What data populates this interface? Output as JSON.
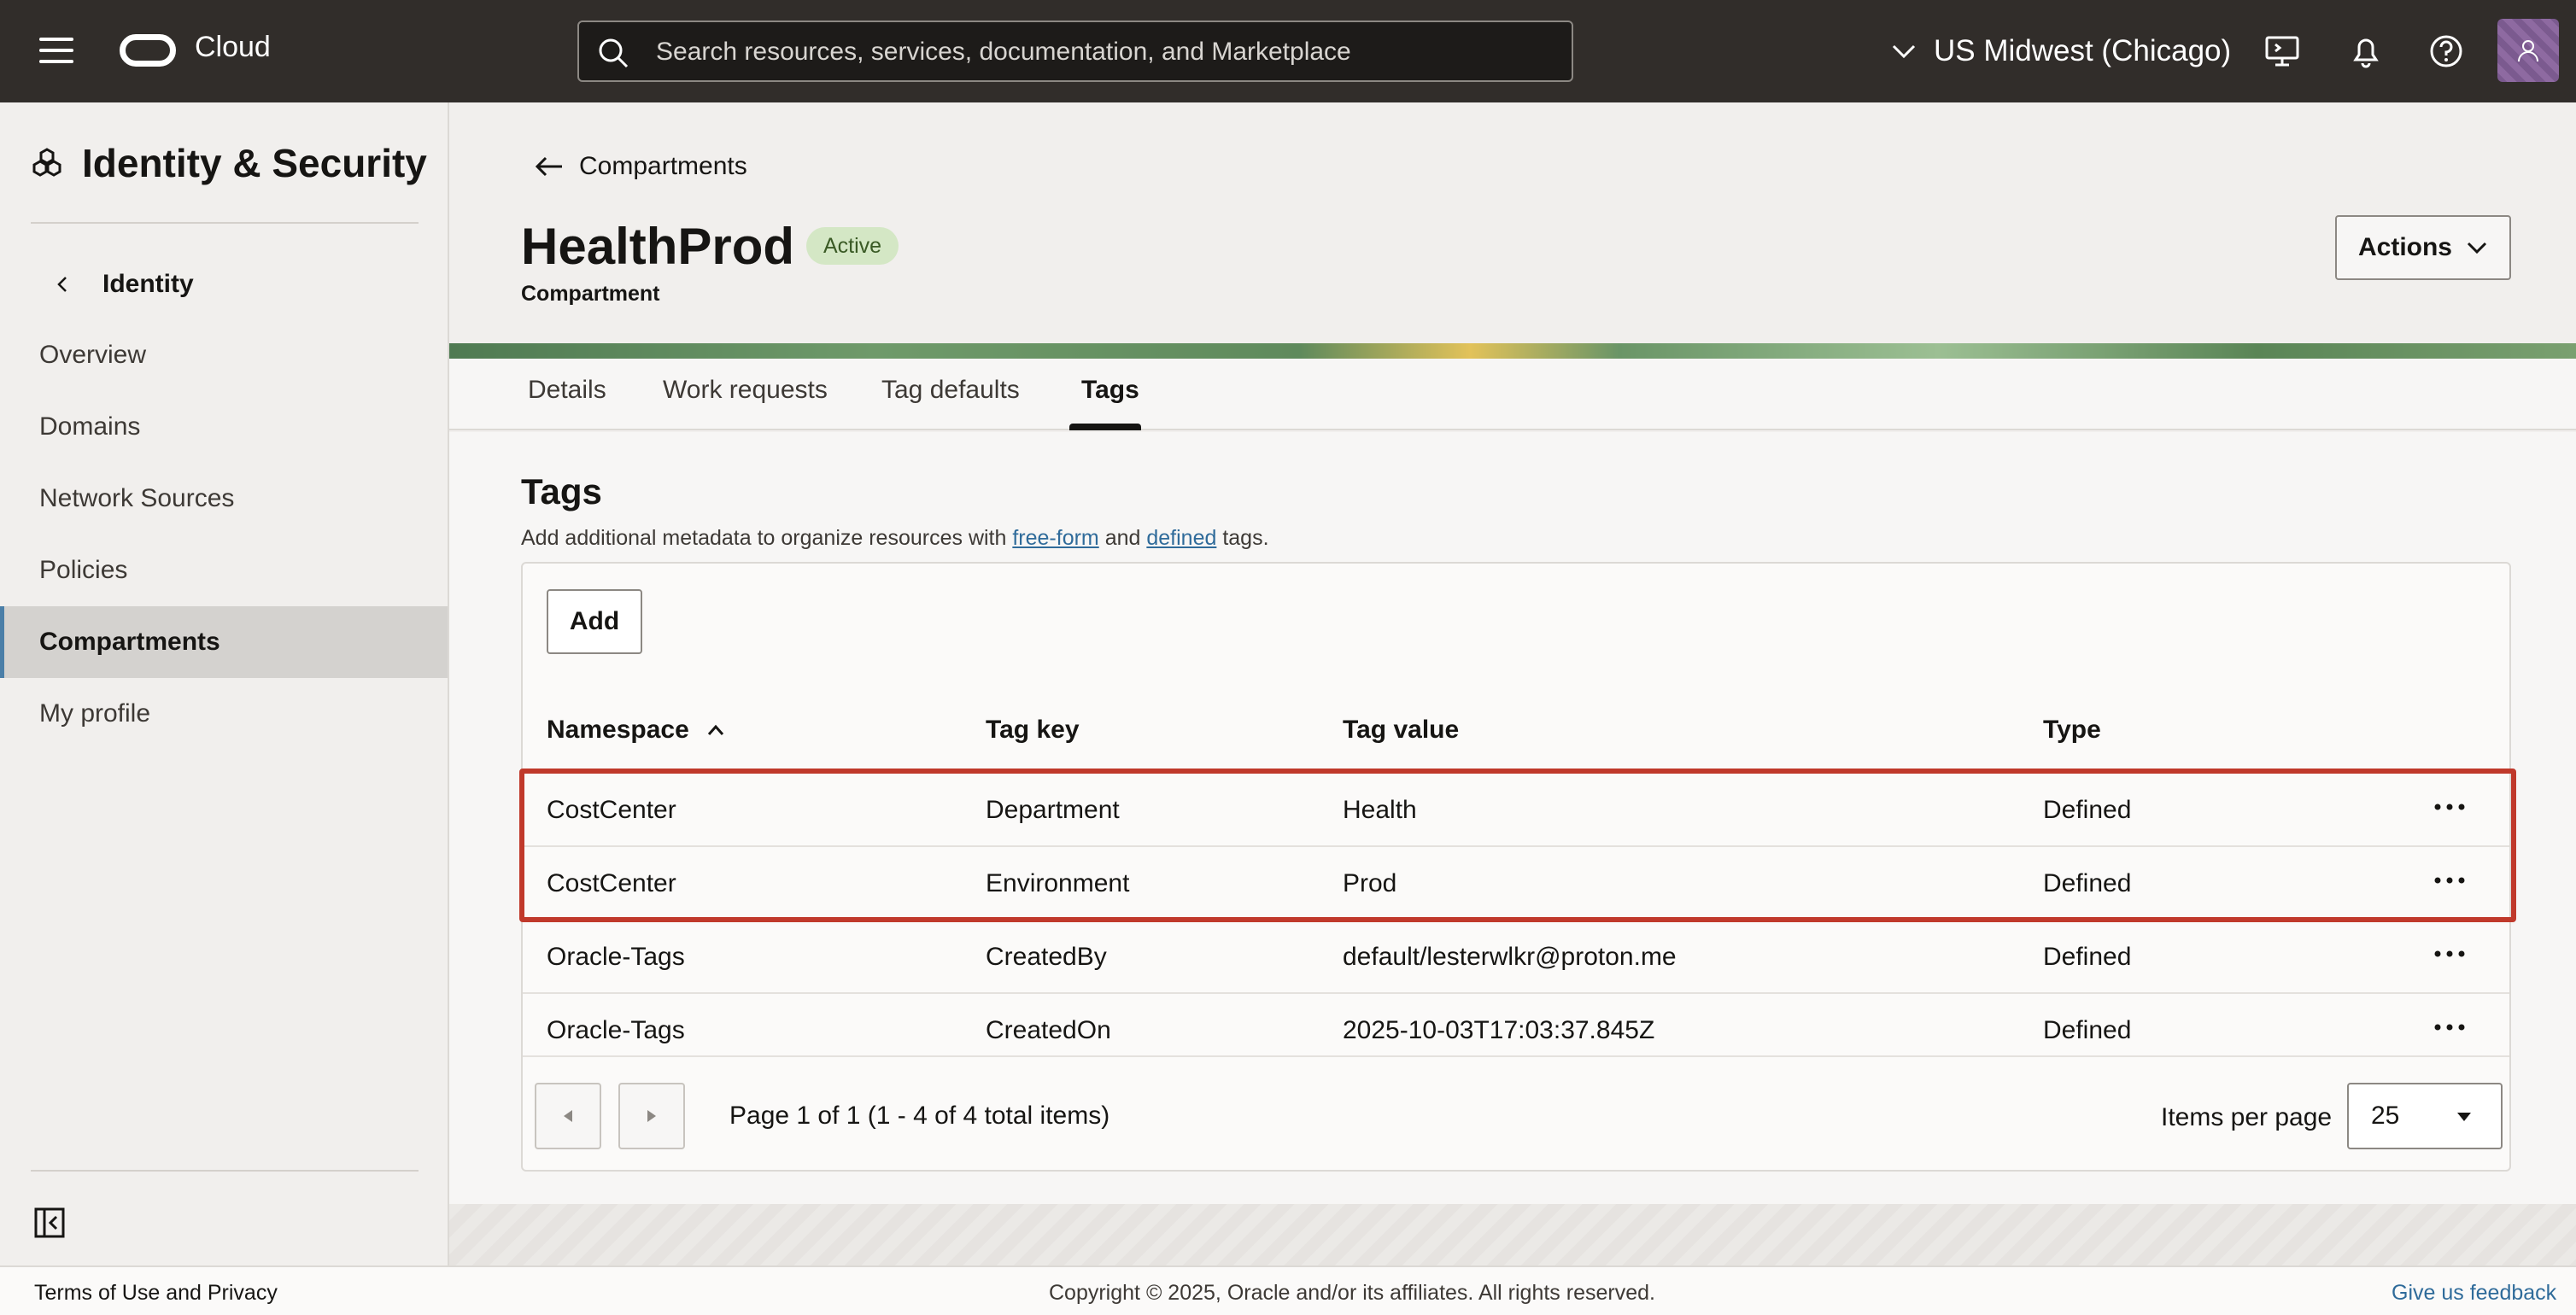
{
  "topbar": {
    "cloud_label": "Cloud",
    "search_placeholder": "Search resources, services, documentation, and Marketplace",
    "region": "US Midwest (Chicago)"
  },
  "sidebar": {
    "title": "Identity & Security",
    "back_label": "Identity",
    "items": [
      {
        "label": "Overview",
        "active": false
      },
      {
        "label": "Domains",
        "active": false
      },
      {
        "label": "Network Sources",
        "active": false
      },
      {
        "label": "Policies",
        "active": false
      },
      {
        "label": "Compartments",
        "active": true
      },
      {
        "label": "My profile",
        "active": false
      }
    ]
  },
  "resource": {
    "breadcrumb": "Compartments",
    "title": "HealthProd",
    "status": "Active",
    "subtitle": "Compartment",
    "actions_label": "Actions"
  },
  "tabs": [
    {
      "label": "Details",
      "active": false
    },
    {
      "label": "Work requests",
      "active": false
    },
    {
      "label": "Tag defaults",
      "active": false
    },
    {
      "label": "Tags",
      "active": true
    }
  ],
  "tags_section": {
    "title": "Tags",
    "desc_prefix": "Add additional metadata to organize resources with ",
    "link_freeform": "free-form",
    "desc_and": " and ",
    "link_defined": "defined",
    "desc_suffix": " tags.",
    "add_label": "Add",
    "columns": [
      "Namespace",
      "Tag key",
      "Tag value",
      "Type"
    ],
    "rows": [
      {
        "namespace": "CostCenter",
        "key": "Department",
        "value": "Health",
        "type": "Defined"
      },
      {
        "namespace": "CostCenter",
        "key": "Environment",
        "value": "Prod",
        "type": "Defined"
      },
      {
        "namespace": "Oracle-Tags",
        "key": "CreatedBy",
        "value": "default/lesterwlkr@proton.me",
        "type": "Defined"
      },
      {
        "namespace": "Oracle-Tags",
        "key": "CreatedOn",
        "value": "2025-10-03T17:03:37.845Z",
        "type": "Defined"
      }
    ],
    "pagination_text": "Page 1 of 1 (1 - 4 of 4 total items)",
    "items_per_page_label": "Items per page",
    "items_per_page_value": "25"
  },
  "footer": {
    "terms": "Terms of Use and Privacy",
    "copyright": "Copyright © 2025, Oracle and/or its affiliates. All rights reserved.",
    "feedback": "Give us feedback"
  },
  "colors": {
    "topbar_bg": "#312d2a",
    "active_badge_bg": "#d4e7c5",
    "highlight_border": "#c0392b",
    "link": "#2f6b9a"
  }
}
